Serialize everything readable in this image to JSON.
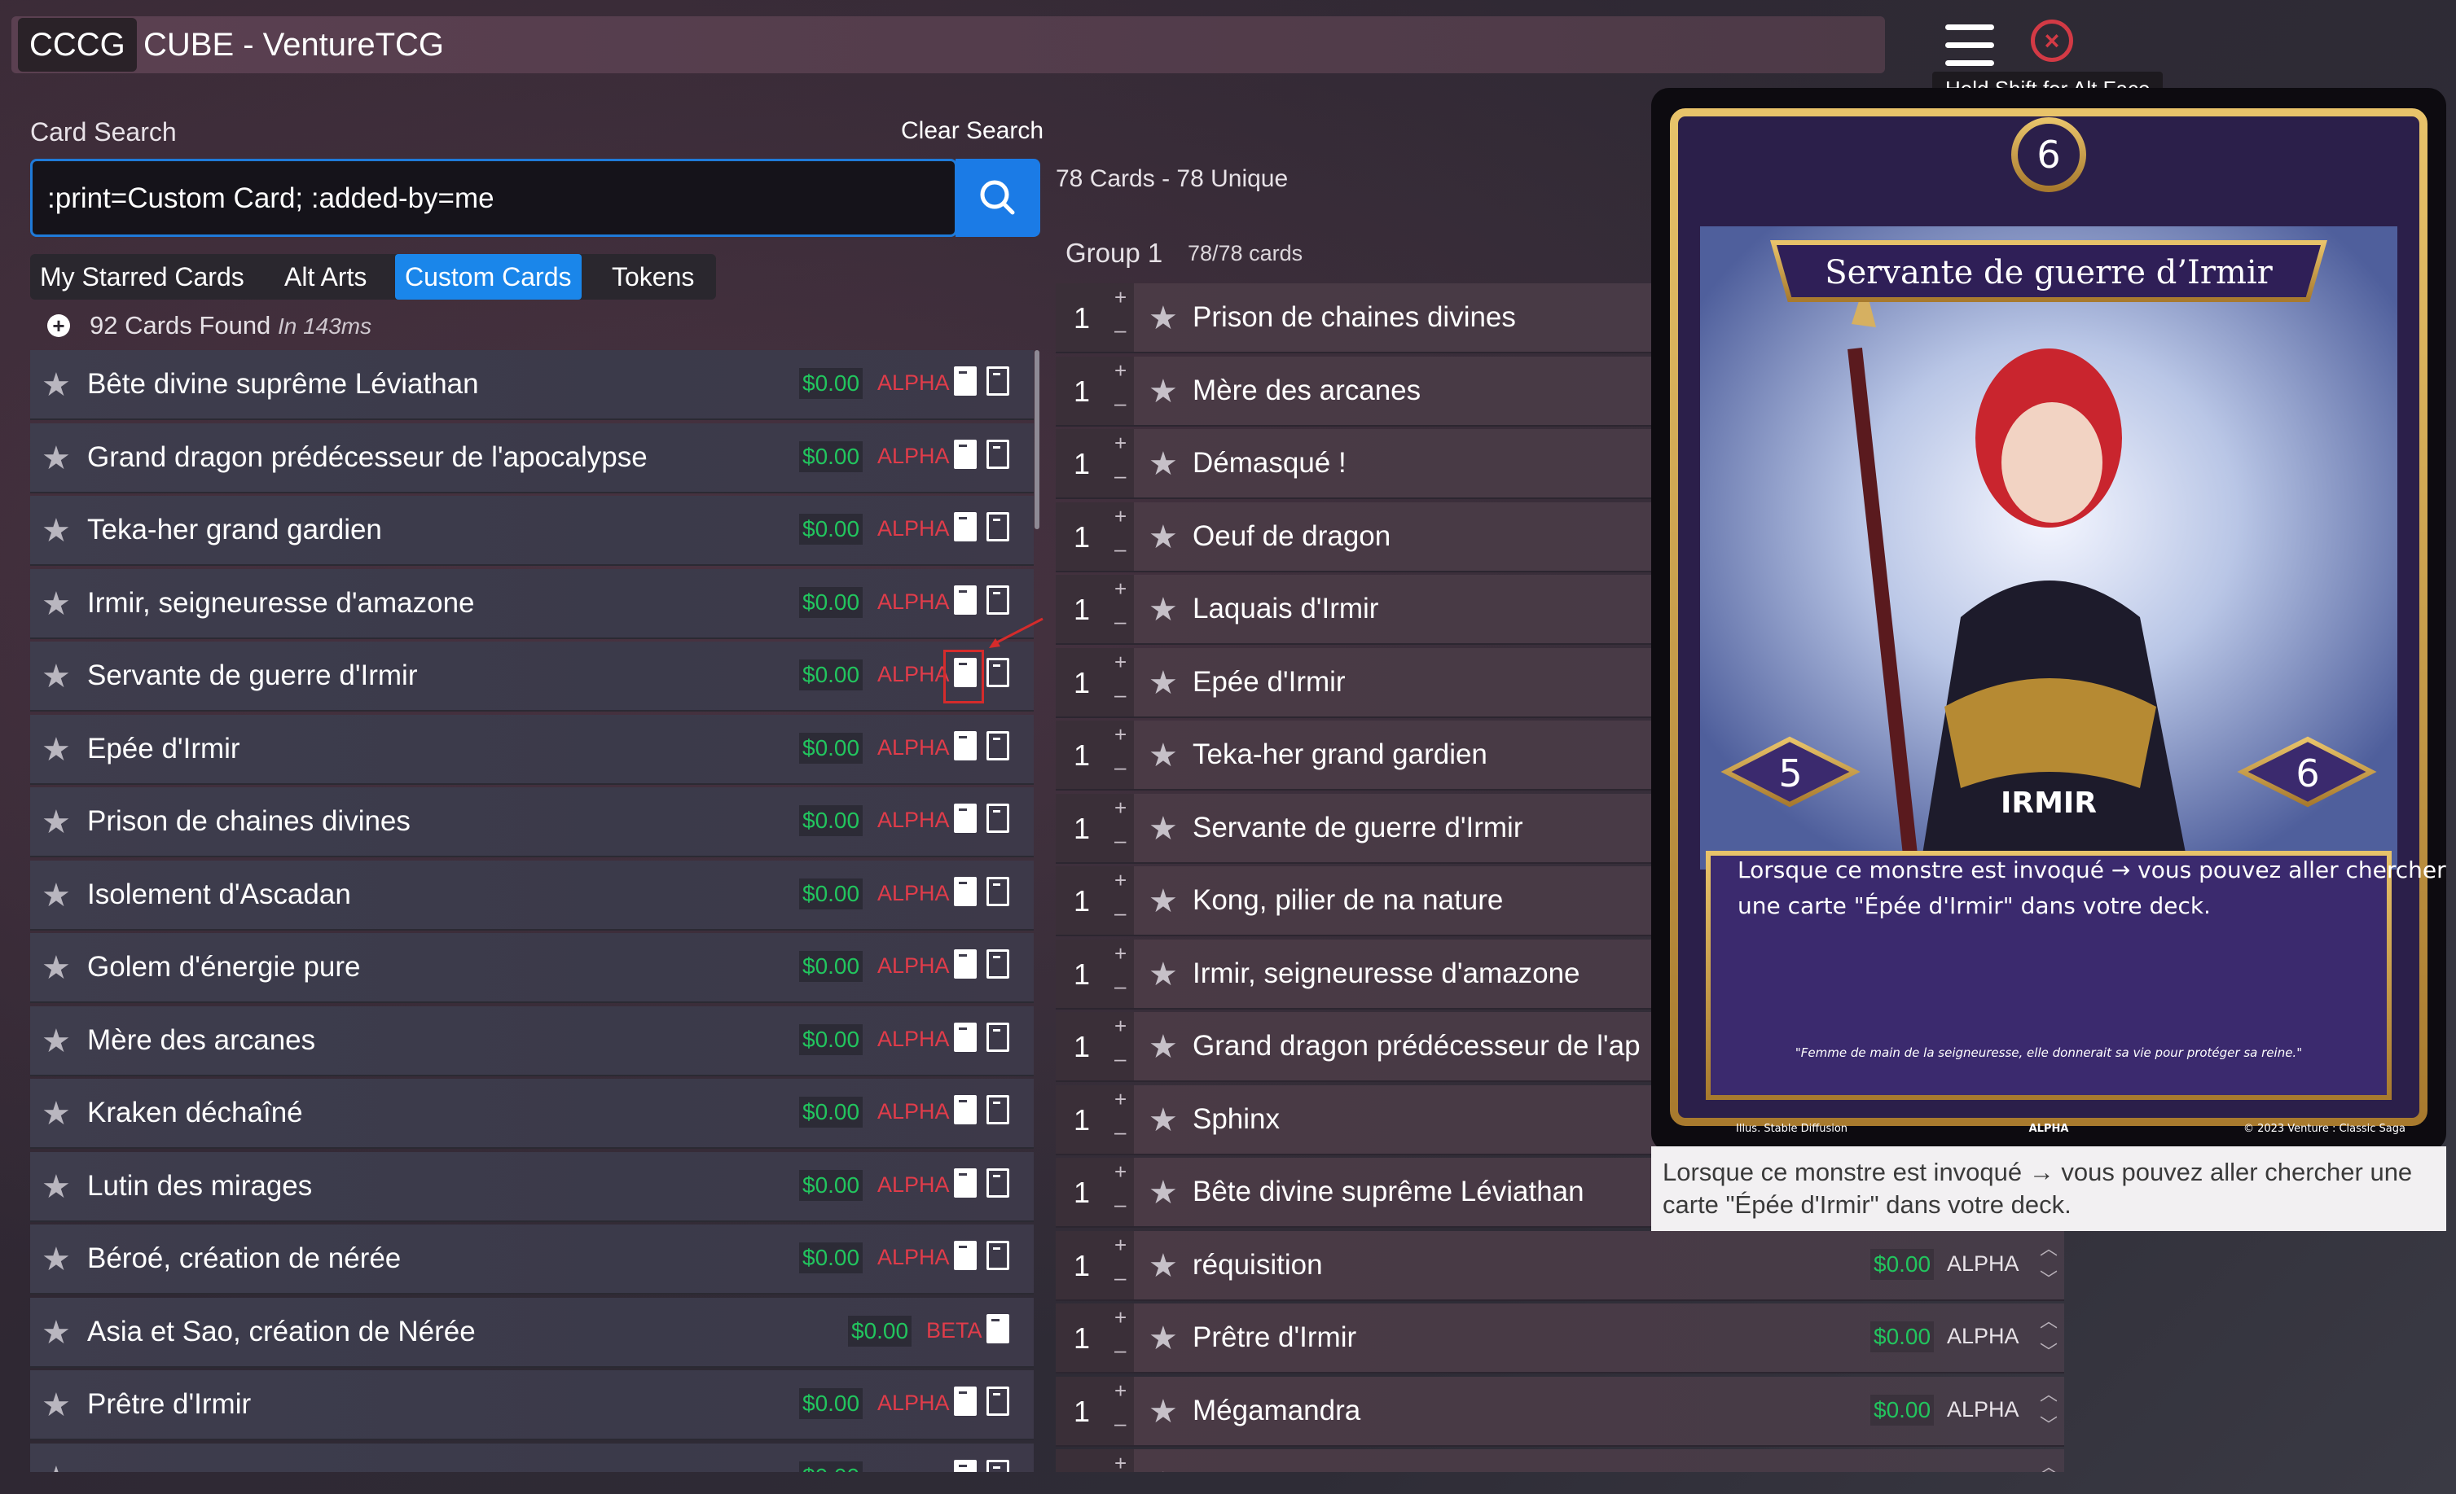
{
  "header": {
    "prefix": "CCCG",
    "title": "CUBE - VentureTCG",
    "tooltip": "Hold Shift for Alt Face"
  },
  "search": {
    "label": "Card Search",
    "clear_label": "Clear Search",
    "query": ":print=Custom Card; :added-by=me",
    "tabs": [
      "My Starred Cards",
      "Alt Arts",
      "Custom Cards",
      "Tokens"
    ],
    "active_tab": "Custom Cards",
    "found_count": "92 Cards Found",
    "found_time": "In 143ms"
  },
  "results": [
    {
      "name": "Bête divine suprême Léviathan",
      "price": "$0.00",
      "set": "ALPHA"
    },
    {
      "name": "Grand dragon prédécesseur de l'apocalypse",
      "price": "$0.00",
      "set": "ALPHA"
    },
    {
      "name": "Teka-her grand gardien",
      "price": "$0.00",
      "set": "ALPHA"
    },
    {
      "name": "Irmir, seigneuresse d'amazone",
      "price": "$0.00",
      "set": "ALPHA"
    },
    {
      "name": "Servante de guerre d'Irmir",
      "price": "$0.00",
      "set": "ALPHA"
    },
    {
      "name": "Epée d'Irmir",
      "price": "$0.00",
      "set": "ALPHA"
    },
    {
      "name": "Prison de chaines divines",
      "price": "$0.00",
      "set": "ALPHA"
    },
    {
      "name": "Isolement d'Ascadan",
      "price": "$0.00",
      "set": "ALPHA"
    },
    {
      "name": "Golem d'énergie pure",
      "price": "$0.00",
      "set": "ALPHA"
    },
    {
      "name": "Mère des arcanes",
      "price": "$0.00",
      "set": "ALPHA"
    },
    {
      "name": "Kraken déchaîné",
      "price": "$0.00",
      "set": "ALPHA"
    },
    {
      "name": "Lutin des mirages",
      "price": "$0.00",
      "set": "ALPHA"
    },
    {
      "name": "Béroé, création de nérée",
      "price": "$0.00",
      "set": "ALPHA"
    },
    {
      "name": "Asia et Sao, création de Nérée",
      "price": "$0.00",
      "set": "BETA"
    },
    {
      "name": "Prêtre d'Irmir",
      "price": "$0.00",
      "set": "ALPHA"
    },
    {
      "name": "",
      "price": "$0.00",
      "set": ""
    }
  ],
  "deck": {
    "summary": "78 Cards - 78 Unique",
    "group_label": "Group 1",
    "group_count": "78/78 cards",
    "rows": [
      {
        "qty": "1",
        "name": "Prison de chaines divines",
        "price": "",
        "set": ""
      },
      {
        "qty": "1",
        "name": "Mère des arcanes",
        "price": "",
        "set": ""
      },
      {
        "qty": "1",
        "name": "Démasqué !",
        "price": "",
        "set": ""
      },
      {
        "qty": "1",
        "name": "Oeuf de dragon",
        "price": "",
        "set": ""
      },
      {
        "qty": "1",
        "name": "Laquais d'Irmir",
        "price": "",
        "set": ""
      },
      {
        "qty": "1",
        "name": "Epée d'Irmir",
        "price": "",
        "set": ""
      },
      {
        "qty": "1",
        "name": "Teka-her grand gardien",
        "price": "",
        "set": ""
      },
      {
        "qty": "1",
        "name": "Servante de guerre d'Irmir",
        "price": "",
        "set": ""
      },
      {
        "qty": "1",
        "name": "Kong, pilier de na nature",
        "price": "",
        "set": ""
      },
      {
        "qty": "1",
        "name": "Irmir, seigneuresse d'amazone",
        "price": "",
        "set": ""
      },
      {
        "qty": "1",
        "name": "Grand dragon prédécesseur de l'ap",
        "price": "",
        "set": ""
      },
      {
        "qty": "1",
        "name": "Sphinx",
        "price": "",
        "set": ""
      },
      {
        "qty": "1",
        "name": "Bête divine suprême Léviathan",
        "price": "",
        "set": ""
      },
      {
        "qty": "1",
        "name": "réquisition",
        "price": "$0.00",
        "set": "ALPHA"
      },
      {
        "qty": "1",
        "name": "Prêtre d'Irmir",
        "price": "$0.00",
        "set": "ALPHA"
      },
      {
        "qty": "1",
        "name": "Mégamandra",
        "price": "$0.00",
        "set": "ALPHA"
      },
      {
        "qty": "",
        "name": "",
        "price": "",
        "set": ""
      }
    ]
  },
  "card_preview": {
    "cost": "6",
    "title": "Servante de guerre d’Irmir",
    "attack": "5",
    "defense": "6",
    "type": "IRMIR",
    "effect_line1": "Lorsque ce monstre est invoqué → vous pouvez aller chercher",
    "effect_line2": "une carte \"Épée d'Irmir\" dans votre deck.",
    "flavor": "\"Femme de main de la seigneuresse, elle donnerait sa vie pour protéger sa reine.\"",
    "illustrator": "Illus. Stable Diffusion",
    "set": "ALPHA",
    "copyright": "© 2023 Venture : Classic Saga",
    "text_box": "Lorsque ce monstre est invoqué → vous pouvez aller chercher une carte \"Épée d'Irmir\" dans votre deck."
  },
  "colors": {
    "accent": "#1b7be6",
    "price_green": "#22c55e",
    "set_red": "#e03c4a",
    "close_red": "#d33a45"
  },
  "icons": [
    "menu-icon",
    "close-icon",
    "search-icon",
    "star-icon",
    "add-circle-icon",
    "card-image-icon",
    "card-outline-icon",
    "chevron-up-icon",
    "chevron-down-icon"
  ]
}
